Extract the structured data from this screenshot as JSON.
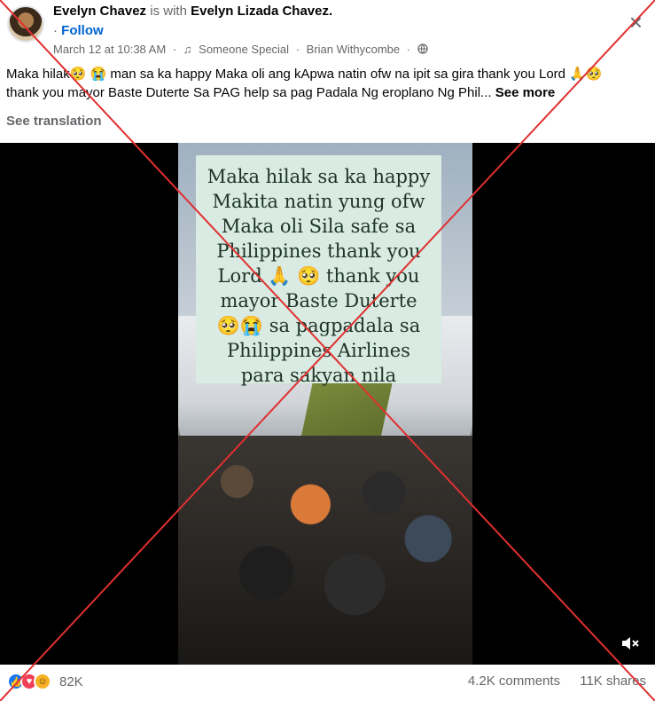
{
  "post": {
    "author": "Evelyn Chavez",
    "with_text": "is with",
    "tagged": "Evelyn Lizada Chavez.",
    "follow_dot": "·",
    "follow_label": "Follow",
    "date": "March 12 at 10:38 AM",
    "music_icon": "♫",
    "song": "Someone Special",
    "artist": "Brian Withycombe",
    "sep": "·",
    "privacy_icon": "globe-icon",
    "close_glyph": "×",
    "caption_line1": "Maka hilak🥺 😭 man sa ka happy Maka oli ang kApwa natin ofw na ipit sa gira thank you Lord 🙏🥺",
    "caption_line2": "thank you mayor Baste Duterte Sa PAG help sa pag Padala Ng eroplano Ng Phil...",
    "see_more": "See more",
    "see_translation": "See translation"
  },
  "video": {
    "overlay_lines": [
      "Maka hilak sa ka happy",
      "Makita natin yung ofw",
      "Maka oli Sila safe sa",
      "Philippines thank you",
      "Lord 🙏 🥺  thank you",
      "mayor Baste Duterte",
      "🥺😭 sa pagpadala  sa",
      "Philippines Airlines",
      "para sakyan nila"
    ],
    "mute_icon": "speaker-muted-icon"
  },
  "footer": {
    "reaction_count": "82K",
    "comments": "4.2K comments",
    "shares": "11K shares"
  },
  "colors": {
    "cross": "#e03030",
    "link": "#0064d1",
    "muted": "#65676b",
    "overlay_bg": "#d9ebe2"
  }
}
